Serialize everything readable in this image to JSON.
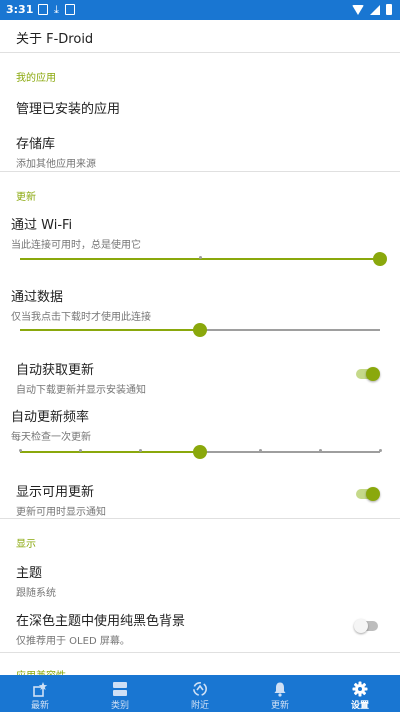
{
  "status": {
    "time": "3:31"
  },
  "header": {
    "about": "关于 F-Droid"
  },
  "sections": {
    "my_apps": "我的应用",
    "updates": "更新",
    "display": "显示",
    "compat": "应用兼容性"
  },
  "prefs": {
    "manage_installed": {
      "title": "管理已安装的应用"
    },
    "repos": {
      "title": "存储库",
      "summary": "添加其他应用来源"
    },
    "wifi": {
      "title": "通过 Wi-Fi",
      "summary": "当此连接可用时，总是使用它",
      "level": 1.0
    },
    "data": {
      "title": "通过数据",
      "summary": "仅当我点击下载时才使用此连接",
      "level": 0.5
    },
    "auto_fetch": {
      "title": "自动获取更新",
      "summary": "自动下载更新并显示安装通知",
      "on": true
    },
    "frequency": {
      "title": "自动更新频率",
      "summary": "每天检查一次更新",
      "level": 0.5,
      "ticks": 7
    },
    "show_updates": {
      "title": "显示可用更新",
      "summary": "更新可用时显示通知",
      "on": true
    },
    "theme": {
      "title": "主题",
      "summary": "跟随系统"
    },
    "black_bg": {
      "title": "在深色主题中使用纯黑色背景",
      "summary": "仅推荐用于 OLED 屏幕。",
      "on": false
    }
  },
  "nav": [
    {
      "label": "最新",
      "icon": "new-star-icon"
    },
    {
      "label": "类别",
      "icon": "categories-icon"
    },
    {
      "label": "附近",
      "icon": "nearby-icon"
    },
    {
      "label": "更新",
      "icon": "bell-icon"
    },
    {
      "label": "设置",
      "icon": "gear-icon",
      "active": true
    }
  ],
  "colors": {
    "primary": "#1976d2",
    "accent": "#8aa80c"
  }
}
